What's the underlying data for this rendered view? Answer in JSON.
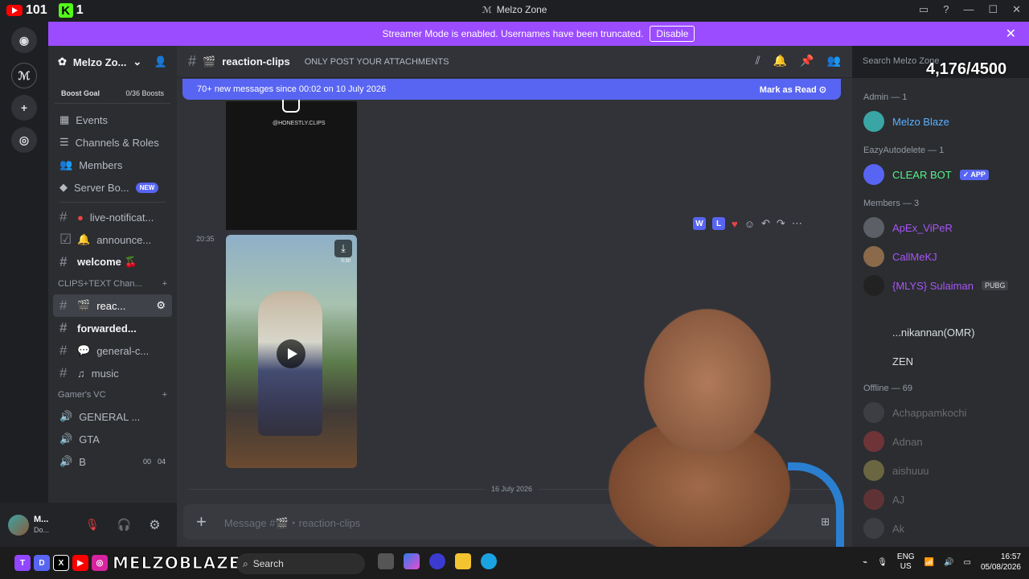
{
  "overlay": {
    "youtube_count": "101",
    "kick_count": "1",
    "counter": "4,176/4500",
    "brand": "MELZOBLAZE"
  },
  "window": {
    "title": "Melzo Zone"
  },
  "banner": {
    "text": "Streamer Mode is enabled. Usernames have been truncated.",
    "button": "Disable"
  },
  "server": {
    "name": "Melzo Zo...",
    "boost_label": "Boost Goal",
    "boost_value": "0/36 Boosts"
  },
  "sidebar": {
    "items": [
      {
        "label": "Events"
      },
      {
        "label": "Channels & Roles"
      },
      {
        "label": "Members"
      },
      {
        "label": "Server Bo...",
        "badge": "NEW"
      }
    ],
    "channels_top": [
      {
        "label": "live-notificat..."
      },
      {
        "label": "announce..."
      },
      {
        "label": "welcome 🍒"
      }
    ],
    "cat_clips": "CLIPS+TEXT Chan...",
    "channels_clips": [
      {
        "label": "reac..."
      },
      {
        "label": "forwarded..."
      },
      {
        "label": "general-c..."
      },
      {
        "label": "music"
      }
    ],
    "cat_vc": "Gamer's VC",
    "voice": [
      {
        "label": "GENERAL ..."
      },
      {
        "label": "GTA"
      },
      {
        "label": "B",
        "count_a": "00",
        "count_b": "04"
      }
    ]
  },
  "user": {
    "name": "M...",
    "status": "Do..."
  },
  "channel": {
    "name": "reaction-clips",
    "topic": "ONLY POST YOUR ATTACHMENTS",
    "search_placeholder": "Search Melzo Zone"
  },
  "newmsg": {
    "text": "70+ new messages since 00:02 on 10 July 2026",
    "mark": "Mark as Read"
  },
  "media": {
    "handle": "@HONESTLY.CLIPS",
    "timestamp": "20:35",
    "date_divider": "16 July 2026",
    "duration": "0:30"
  },
  "composer": {
    "placeholder": "Message #🎬・reaction-clips"
  },
  "members": {
    "admin_header": "Admin — 1",
    "admin": [
      {
        "name": "Melzo Blaze",
        "color": "#5ab0ff"
      }
    ],
    "bot_header": "EazyAutodelete — 1",
    "bot": [
      {
        "name": "CLEAR BOT",
        "badge": "APP",
        "color": "#57f287"
      }
    ],
    "members_header": "Members — 3",
    "list": [
      {
        "name": "ApEx_ViPeR"
      },
      {
        "name": "CallMeKJ"
      },
      {
        "name": "{MLYS} Sulaiman",
        "badge": "PUBG"
      },
      {
        "name": "...nikannan(OMR)"
      },
      {
        "name": "ZEN"
      }
    ],
    "offline_header": "Offline — 69",
    "offline": [
      {
        "name": "Achappamkochi"
      },
      {
        "name": "Adnan"
      },
      {
        "name": "aishuuu"
      },
      {
        "name": "AJ"
      },
      {
        "name": "Ak"
      }
    ]
  },
  "taskbar": {
    "search": "Search",
    "lang_a": "ENG",
    "lang_b": "US",
    "time": "16:57",
    "date": "05/08/2026"
  },
  "colors": {
    "accent": "#5865f2",
    "streamer": "#9b4cff",
    "purple_name": "#a855f7"
  }
}
